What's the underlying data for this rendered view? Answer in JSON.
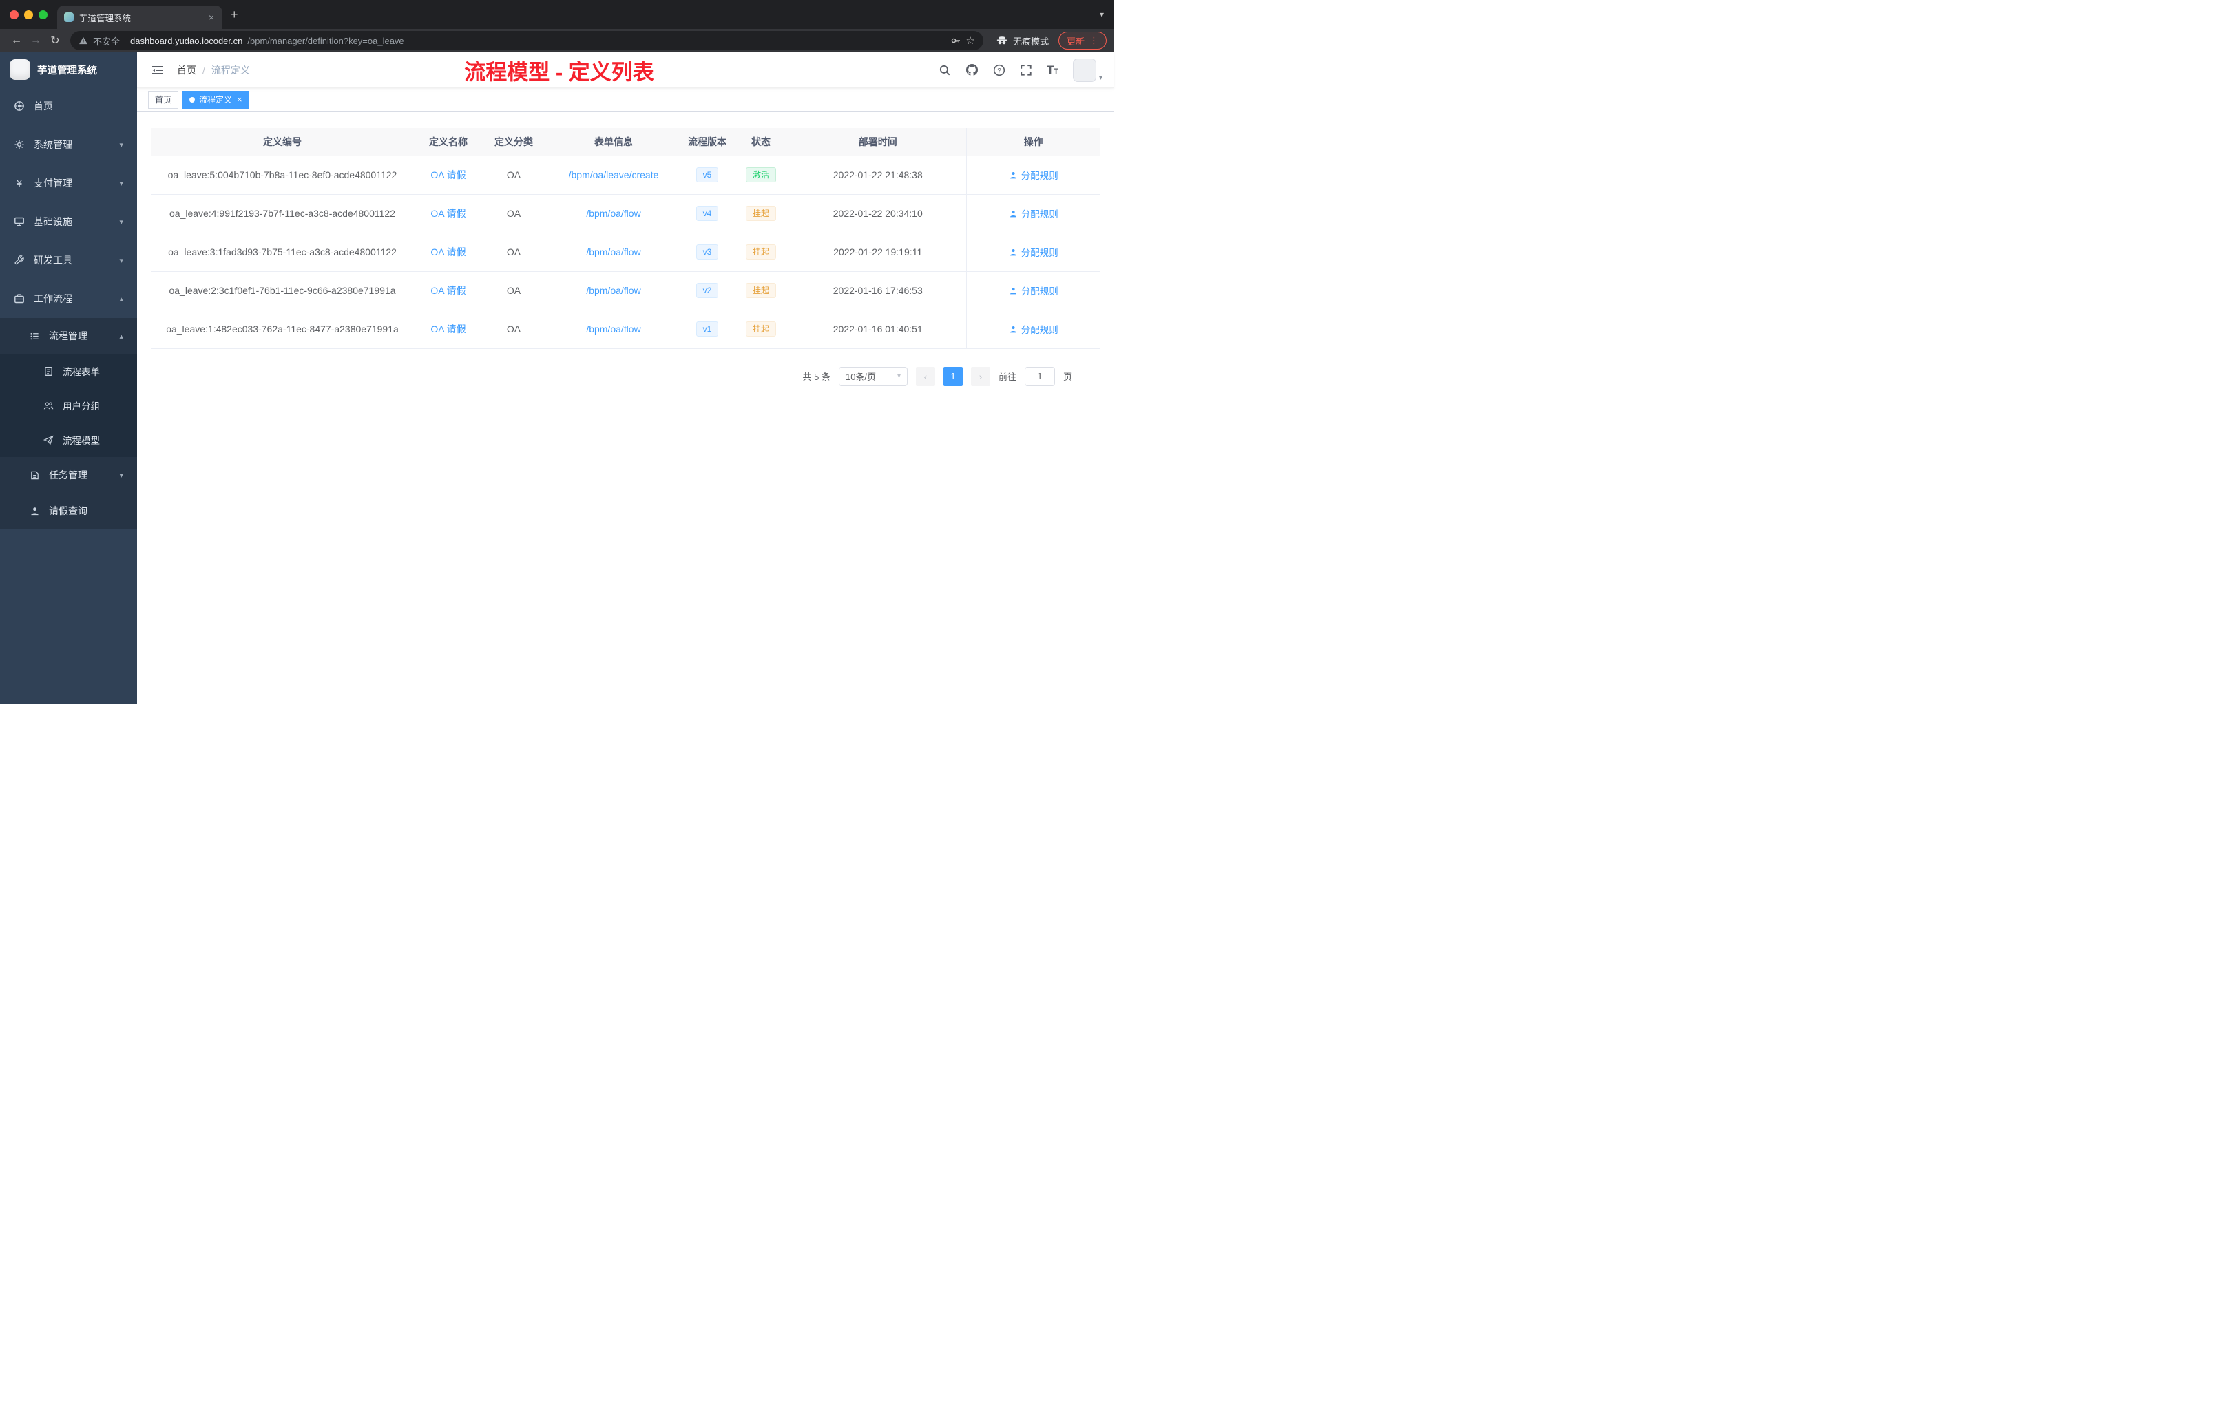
{
  "colors": {
    "accent": "#409eff",
    "success": "#13ce66",
    "warning": "#e6a23c",
    "annotation": "#f5222d",
    "update_accent": "#f45b4e"
  },
  "icons": {
    "back": "←",
    "forward": "→",
    "reload": "↻",
    "star": "☆",
    "menu_dots": "⋮",
    "tab_chevron": "▾",
    "new_tab": "+",
    "close_tab": "×",
    "chevron_down": "▾",
    "chevron_up": "▴",
    "caret_down": "▾",
    "prev": "‹",
    "next": "›",
    "select_caret": "▾",
    "yen": "¥",
    "font_large": "T",
    "font_small": "T",
    "tag_close": "×"
  },
  "browser": {
    "tab_title": "芋道管理系统",
    "security_label": "不安全",
    "url_host": "dashboard.yudao.iocoder.cn",
    "url_path": "/bpm/manager/definition?key=oa_leave",
    "incognito_label": "无痕模式",
    "update_label": "更新"
  },
  "sidebar": {
    "app_title": "芋道管理系统",
    "items": [
      {
        "label": "首页"
      },
      {
        "label": "系统管理"
      },
      {
        "label": "支付管理"
      },
      {
        "label": "基础设施"
      },
      {
        "label": "研发工具"
      },
      {
        "label": "工作流程"
      },
      {
        "label": "流程管理"
      },
      {
        "label": "流程表单"
      },
      {
        "label": "用户分组"
      },
      {
        "label": "流程模型"
      },
      {
        "label": "任务管理"
      },
      {
        "label": "请假查询"
      }
    ]
  },
  "header": {
    "breadcrumb": {
      "home": "首页",
      "separator": "/",
      "current": "流程定义"
    },
    "annotation": "流程模型 - 定义列表"
  },
  "tags": {
    "home": "首页",
    "active": "流程定义"
  },
  "table": {
    "columns": [
      "定义编号",
      "定义名称",
      "定义分类",
      "表单信息",
      "流程版本",
      "状态",
      "部署时间",
      "操作"
    ],
    "rows": [
      {
        "id": "oa_leave:5:004b710b-7b8a-11ec-8ef0-acde48001122",
        "name": "OA 请假",
        "category": "OA",
        "form": "/bpm/oa/leave/create",
        "version": "v5",
        "status": "激活",
        "time": "2022-01-22 21:48:38",
        "action": "分配规则"
      },
      {
        "id": "oa_leave:4:991f2193-7b7f-11ec-a3c8-acde48001122",
        "name": "OA 请假",
        "category": "OA",
        "form": "/bpm/oa/flow",
        "version": "v4",
        "status": "挂起",
        "time": "2022-01-22 20:34:10",
        "action": "分配规则"
      },
      {
        "id": "oa_leave:3:1fad3d93-7b75-11ec-a3c8-acde48001122",
        "name": "OA 请假",
        "category": "OA",
        "form": "/bpm/oa/flow",
        "version": "v3",
        "status": "挂起",
        "time": "2022-01-22 19:19:11",
        "action": "分配规则"
      },
      {
        "id": "oa_leave:2:3c1f0ef1-76b1-11ec-9c66-a2380e71991a",
        "name": "OA 请假",
        "category": "OA",
        "form": "/bpm/oa/flow",
        "version": "v2",
        "status": "挂起",
        "time": "2022-01-16 17:46:53",
        "action": "分配规则"
      },
      {
        "id": "oa_leave:1:482ec033-762a-11ec-8477-a2380e71991a",
        "name": "OA 请假",
        "category": "OA",
        "form": "/bpm/oa/flow",
        "version": "v1",
        "status": "挂起",
        "time": "2022-01-16 01:40:51",
        "action": "分配规则"
      }
    ]
  },
  "pagination": {
    "total": "共 5 条",
    "page_size": "10条/页",
    "current_page": "1",
    "goto_label": "前往",
    "goto_value": "1",
    "goto_unit": "页"
  }
}
